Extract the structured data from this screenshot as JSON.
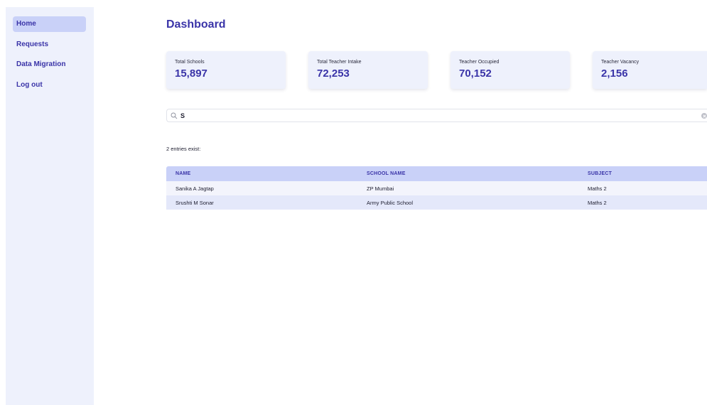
{
  "sidebar": {
    "items": [
      {
        "label": "Home",
        "active": true
      },
      {
        "label": "Requests",
        "active": false
      },
      {
        "label": "Data Migration",
        "active": false
      },
      {
        "label": "Log out",
        "active": false
      }
    ]
  },
  "page": {
    "title": "Dashboard"
  },
  "stats": [
    {
      "label": "Total Schools",
      "value": "15,897"
    },
    {
      "label": "Total Teacher Intake",
      "value": "72,253"
    },
    {
      "label": "Teacher Occupied",
      "value": "70,152"
    },
    {
      "label": "Teacher Vacancy",
      "value": "2,156"
    }
  ],
  "search": {
    "value": "S",
    "icon": "search-icon",
    "clear_icon": "clear-icon"
  },
  "results": {
    "summary": "2 entries exist:",
    "columns": [
      "NAME",
      "SCHOOL NAME",
      "SUBJECT"
    ],
    "rows": [
      [
        "Sanika A Jagtap",
        "ZP Mumbai",
        "Maths 2"
      ],
      [
        "Srushti M Sonar",
        "Army Public School",
        "Maths 2"
      ]
    ]
  },
  "colors": {
    "accent": "#3a34a8",
    "sidebar_bg": "#eef1fc",
    "active_bg": "#c9d1f8",
    "row_alt": "#e4e8fa"
  }
}
